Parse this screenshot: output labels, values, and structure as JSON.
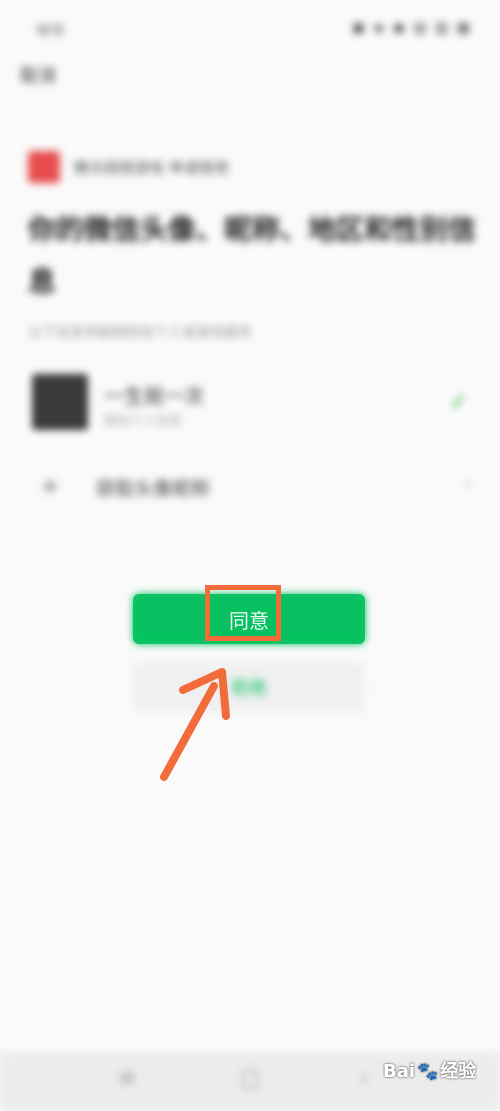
{
  "status_bar": {
    "time": "中午",
    "icons": "▣ ◈ ◉ ▤ ▥ ▦"
  },
  "header": {
    "cancel_label": "取消"
  },
  "auth": {
    "app_name": "腾讯视频游戏 申请使用",
    "headline": "你的微信头像、昵称、地区和性别信息",
    "subnote": "以下信息将被授权给个人或游戏服务",
    "profile": {
      "nickname": "一生就一次",
      "sub": "微信个人信息"
    },
    "new_avatar_label": "获取头像昵称"
  },
  "buttons": {
    "agree_label": "同意",
    "decline_label": "拒绝"
  },
  "watermark": {
    "text_left": "Bai",
    "text_right": "经验",
    "paw": "🐾"
  },
  "colors": {
    "primary": "#07c160",
    "annotation": "#f26b3a"
  }
}
